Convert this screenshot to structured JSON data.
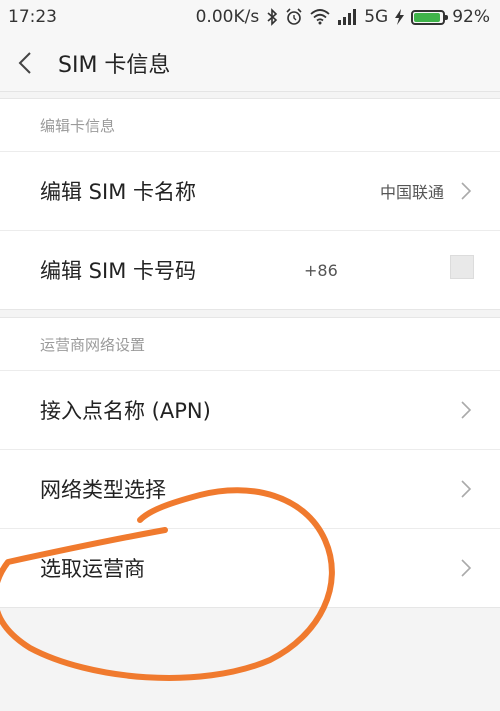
{
  "status_bar": {
    "time": "17:23",
    "net_speed": "0.00K/s",
    "network": "5G",
    "battery": "92%",
    "battery_level": 0.92,
    "battery_color": "#3fb34a"
  },
  "header": {
    "title": "SIM 卡信息"
  },
  "card_info": {
    "section_title": "编辑卡信息",
    "items": [
      {
        "label": "编辑 SIM 卡名称",
        "value": "中国联通"
      },
      {
        "label": "编辑 SIM 卡号码",
        "value": "+86"
      }
    ]
  },
  "network_settings": {
    "section_title": "运营商网络设置",
    "items": [
      {
        "label": "接入点名称 (APN)"
      },
      {
        "label": "网络类型选择"
      },
      {
        "label": "选取运营商"
      }
    ]
  },
  "annotation": {
    "stroke_color": "#f07a2e"
  }
}
